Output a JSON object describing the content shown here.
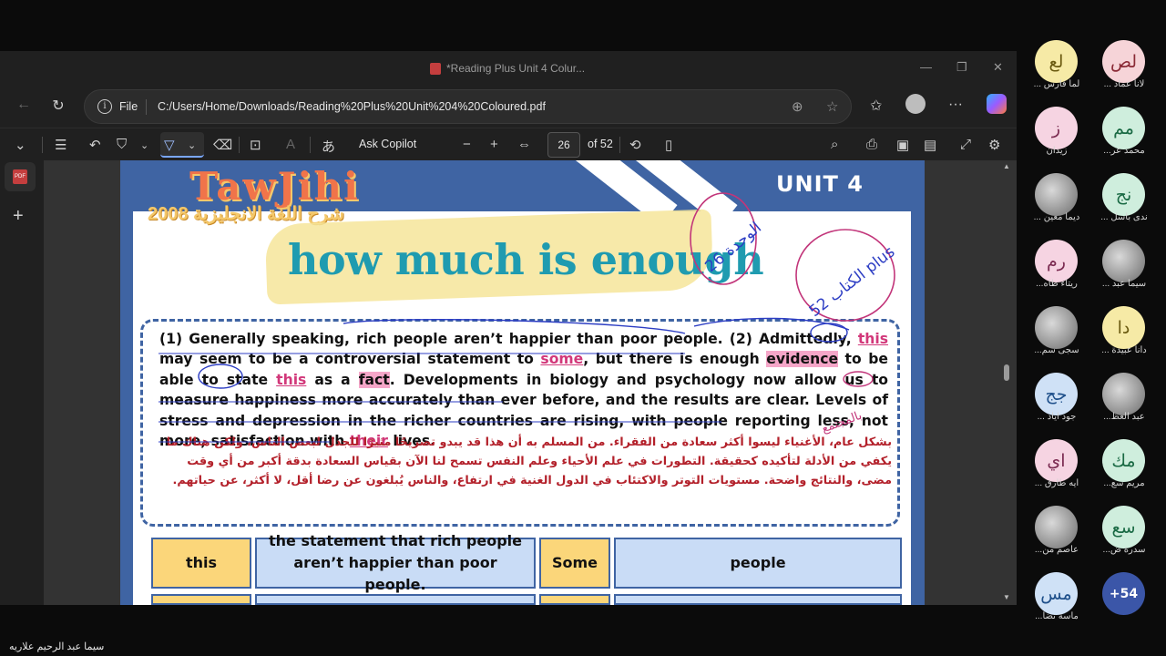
{
  "window": {
    "title": "*Reading Plus Unit 4 Colur..."
  },
  "address": {
    "scheme_label": "File",
    "url": "C:/Users/Home/Downloads/Reading%20Plus%20Unit%204%20Coloured.pdf"
  },
  "pdf_toolbar": {
    "ask_copilot": "Ask Copilot",
    "page_current": "26",
    "page_total": "of 52"
  },
  "page": {
    "unit_label": "UNIT 4",
    "logo_title": "TawJihi",
    "logo_subtitle": "شرح اللغة الانجليزية 2008",
    "heading": "how much is enough",
    "passage": {
      "s1": "(1) Generally speaking, rich people aren’t happier than poor people. (2) Admittedly, ",
      "this1": "this",
      "s2": " may seem to be a controversial statement to ",
      "some": "some",
      "s3": ", but there is enough ",
      "evidence": "evidence",
      "s4": " to be able to state ",
      "this2": "this",
      "s5": " as a ",
      "fact": "fact",
      "s6": ". Developments in biology and psychology now allow us to measure happiness more accurately than ever before, and the results are clear. Levels of stress and depression in the richer countries are rising, with people reporting less, not more, satisfaction with ",
      "their": "their",
      "s7": " lives."
    },
    "arabic": "بشكل عام، الأغنياء ليسوا أكثر سعادة من الفقراء. من المسلم به أن هذا قد يبدو تصريحًا مثيرًا للجدل لبعض الناس، ولكن هناك ما يكفي من الأدلة لتأكيده كحقيقة. التطورات في علم الأحياء وعلم النفس تسمح لنا الآن بقياس السعادة بدقة أكبر من أي وقت مضى، والنتائج واضحة. مستويات التوتر والاكتئاب في الدول الغنية في ارتفاع، والناس يُبلغون عن رضا أقل، لا أكثر، عن حياتهم.",
    "table": {
      "c1": "this",
      "c2": "the statement that rich people aren’t happier than poor people.",
      "c3": "Some",
      "c4": "people"
    }
  },
  "participants": [
    {
      "initials": "لع",
      "name": "لما فارس ...",
      "bg": "#f6eaa6",
      "fg": "#6a5a10"
    },
    {
      "initials": "لص",
      "name": "لانا عماد ...",
      "bg": "#f6d4d8",
      "fg": "#8a2a36"
    },
    {
      "initials": "ز",
      "name": "زيدان",
      "bg": "#f6d4e2",
      "fg": "#7a2a50"
    },
    {
      "initials": "مم",
      "name": "محمد عر...",
      "bg": "#cfeedd",
      "fg": "#1a6a44"
    },
    {
      "initials": "",
      "name": "ديما معين ...",
      "photo": true
    },
    {
      "initials": "نج",
      "name": "ندى باسل ...",
      "bg": "#cfeedd",
      "fg": "#1a6a44"
    },
    {
      "initials": "رم",
      "name": "ريتاء طاه...",
      "bg": "#f6d4e2",
      "fg": "#7a2a50"
    },
    {
      "initials": "",
      "name": "سيما عبد ...",
      "photo": true
    },
    {
      "initials": "",
      "name": "سجى سم...",
      "photo": true
    },
    {
      "initials": "دا",
      "name": "دانا عبيدة ...",
      "bg": "#f6eaa6",
      "fg": "#6a5a10"
    },
    {
      "initials": "جج",
      "name": "جود اياد ...",
      "bg": "#cfe1f6",
      "fg": "#1e4f8a"
    },
    {
      "initials": "",
      "name": "عبد العظ...",
      "photo": true
    },
    {
      "initials": "اي",
      "name": "ايه طارق ...",
      "bg": "#f6d4e2",
      "fg": "#7a2a50"
    },
    {
      "initials": "مك",
      "name": "مريم سع...",
      "bg": "#cfeedd",
      "fg": "#1a6a44"
    },
    {
      "initials": "",
      "name": "عاصم من...",
      "photo": true
    },
    {
      "initials": "سع",
      "name": "سدرة ض...",
      "bg": "#cfeedd",
      "fg": "#1a6a44"
    },
    {
      "initials": "مس",
      "name": "ماسة نضا...",
      "bg": "#cfe1f6",
      "fg": "#1e4f8a"
    }
  ],
  "more_participants": "+54",
  "presenter_name": "سيما عبد الرحيم علاريه",
  "annotations": {
    "a1": "26 الوحدة",
    "a2": "52 الكتاب plus",
    "a3": "بالمجتمع"
  }
}
